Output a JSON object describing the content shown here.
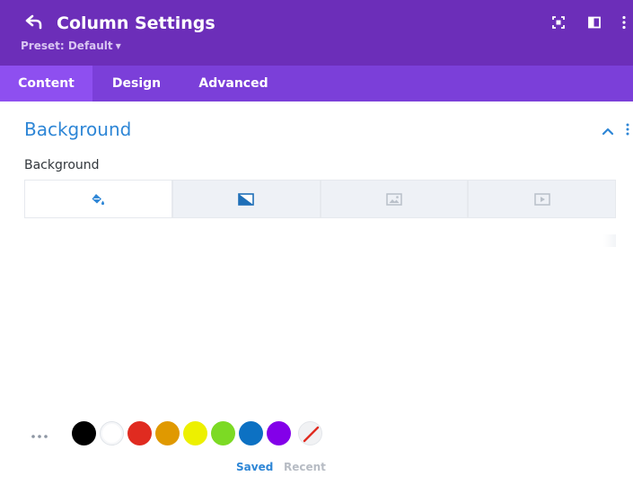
{
  "header": {
    "title": "Column Settings",
    "preset_label": "Preset: Default",
    "back_icon": "undo-arrow-icon",
    "right_icons": [
      "expand-icon",
      "split-view-icon",
      "more-vertical-icon"
    ],
    "background_color": "#6c2eb9"
  },
  "tabs": [
    {
      "label": "Content",
      "active": true
    },
    {
      "label": "Design",
      "active": false
    },
    {
      "label": "Advanced",
      "active": false
    }
  ],
  "section": {
    "title": "Background",
    "field_label": "Background",
    "background_types": [
      {
        "icon": "paint-bucket-icon",
        "active": true
      },
      {
        "icon": "gradient-icon",
        "active": false
      },
      {
        "icon": "image-icon",
        "active": false
      },
      {
        "icon": "video-icon",
        "active": false
      }
    ]
  },
  "palette": {
    "colors": [
      "#000000",
      "#ffffff",
      "#e02b20",
      "#e09900",
      "#edf000",
      "#7cda24",
      "#0c71c3",
      "#8300e9"
    ],
    "none_icon": "no-color-icon",
    "tabs": {
      "saved": "Saved",
      "recent": "Recent"
    },
    "accent": "#2e86d6"
  }
}
